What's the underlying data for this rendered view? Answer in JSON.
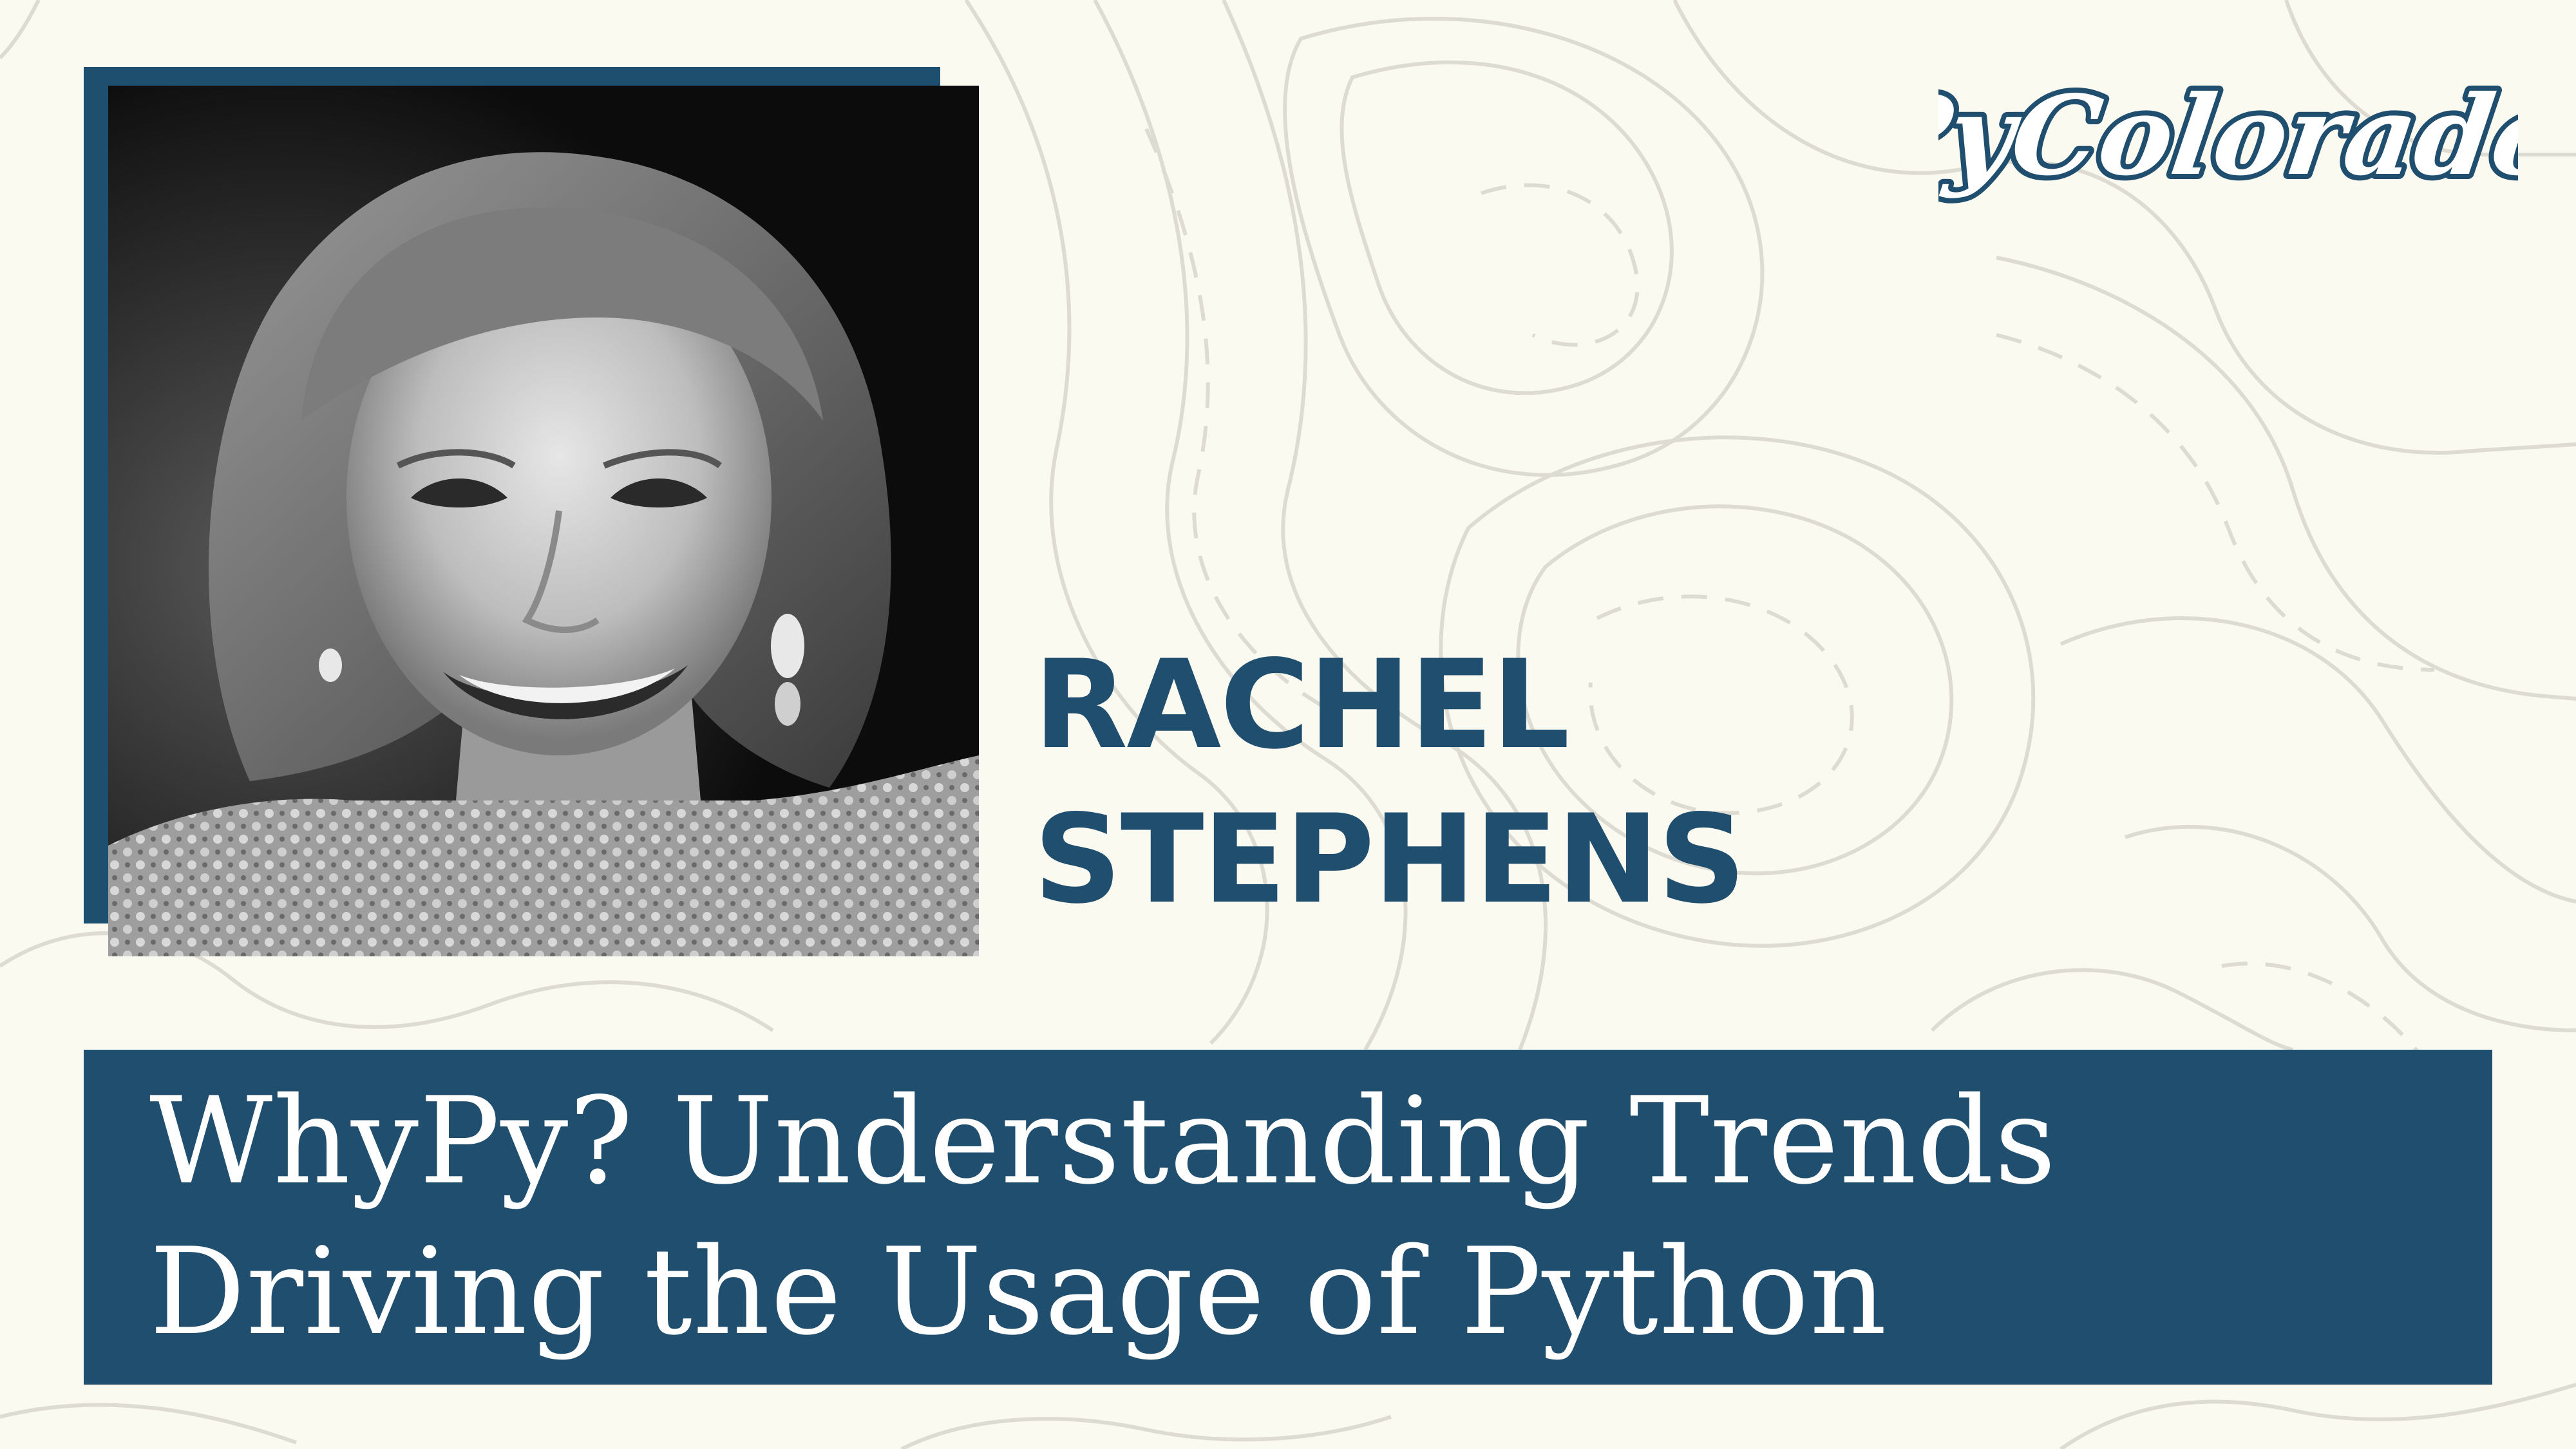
{
  "event": {
    "logo_text": "PyColorado",
    "brand_color": "#1f4e6e",
    "background_color": "#fbfaf1"
  },
  "speaker": {
    "first_name": "RACHEL",
    "last_name": "STEPHENS",
    "photo": "speaker-portrait-black-and-white"
  },
  "talk": {
    "title_line_1": "WhyPy? Understanding Trends",
    "title_line_2": "Driving the Usage of Python"
  }
}
